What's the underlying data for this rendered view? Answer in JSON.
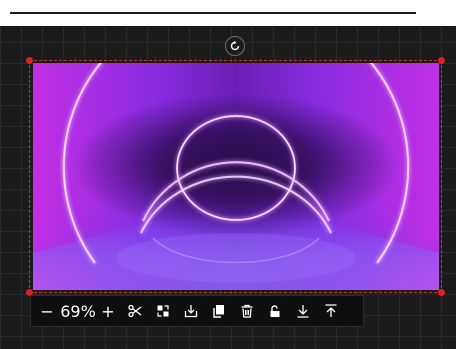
{
  "editor": {
    "zoom_label": "69%",
    "zoom_out_symbol": "−",
    "zoom_in_symbol": "+"
  },
  "colors": {
    "canvas_bg": "#1b1b1b",
    "grid_line": "#2a2a2a",
    "selection_handle": "#e02020",
    "toolbar_bg": "#0f0f0f",
    "neon_ring": "#f2c6ff"
  },
  "toolbar": {
    "icons": [
      "scissors-icon",
      "replace-icon",
      "download-into-icon",
      "duplicate-icon",
      "trash-icon",
      "unlock-icon",
      "send-backward-icon",
      "bring-to-front-icon"
    ]
  }
}
